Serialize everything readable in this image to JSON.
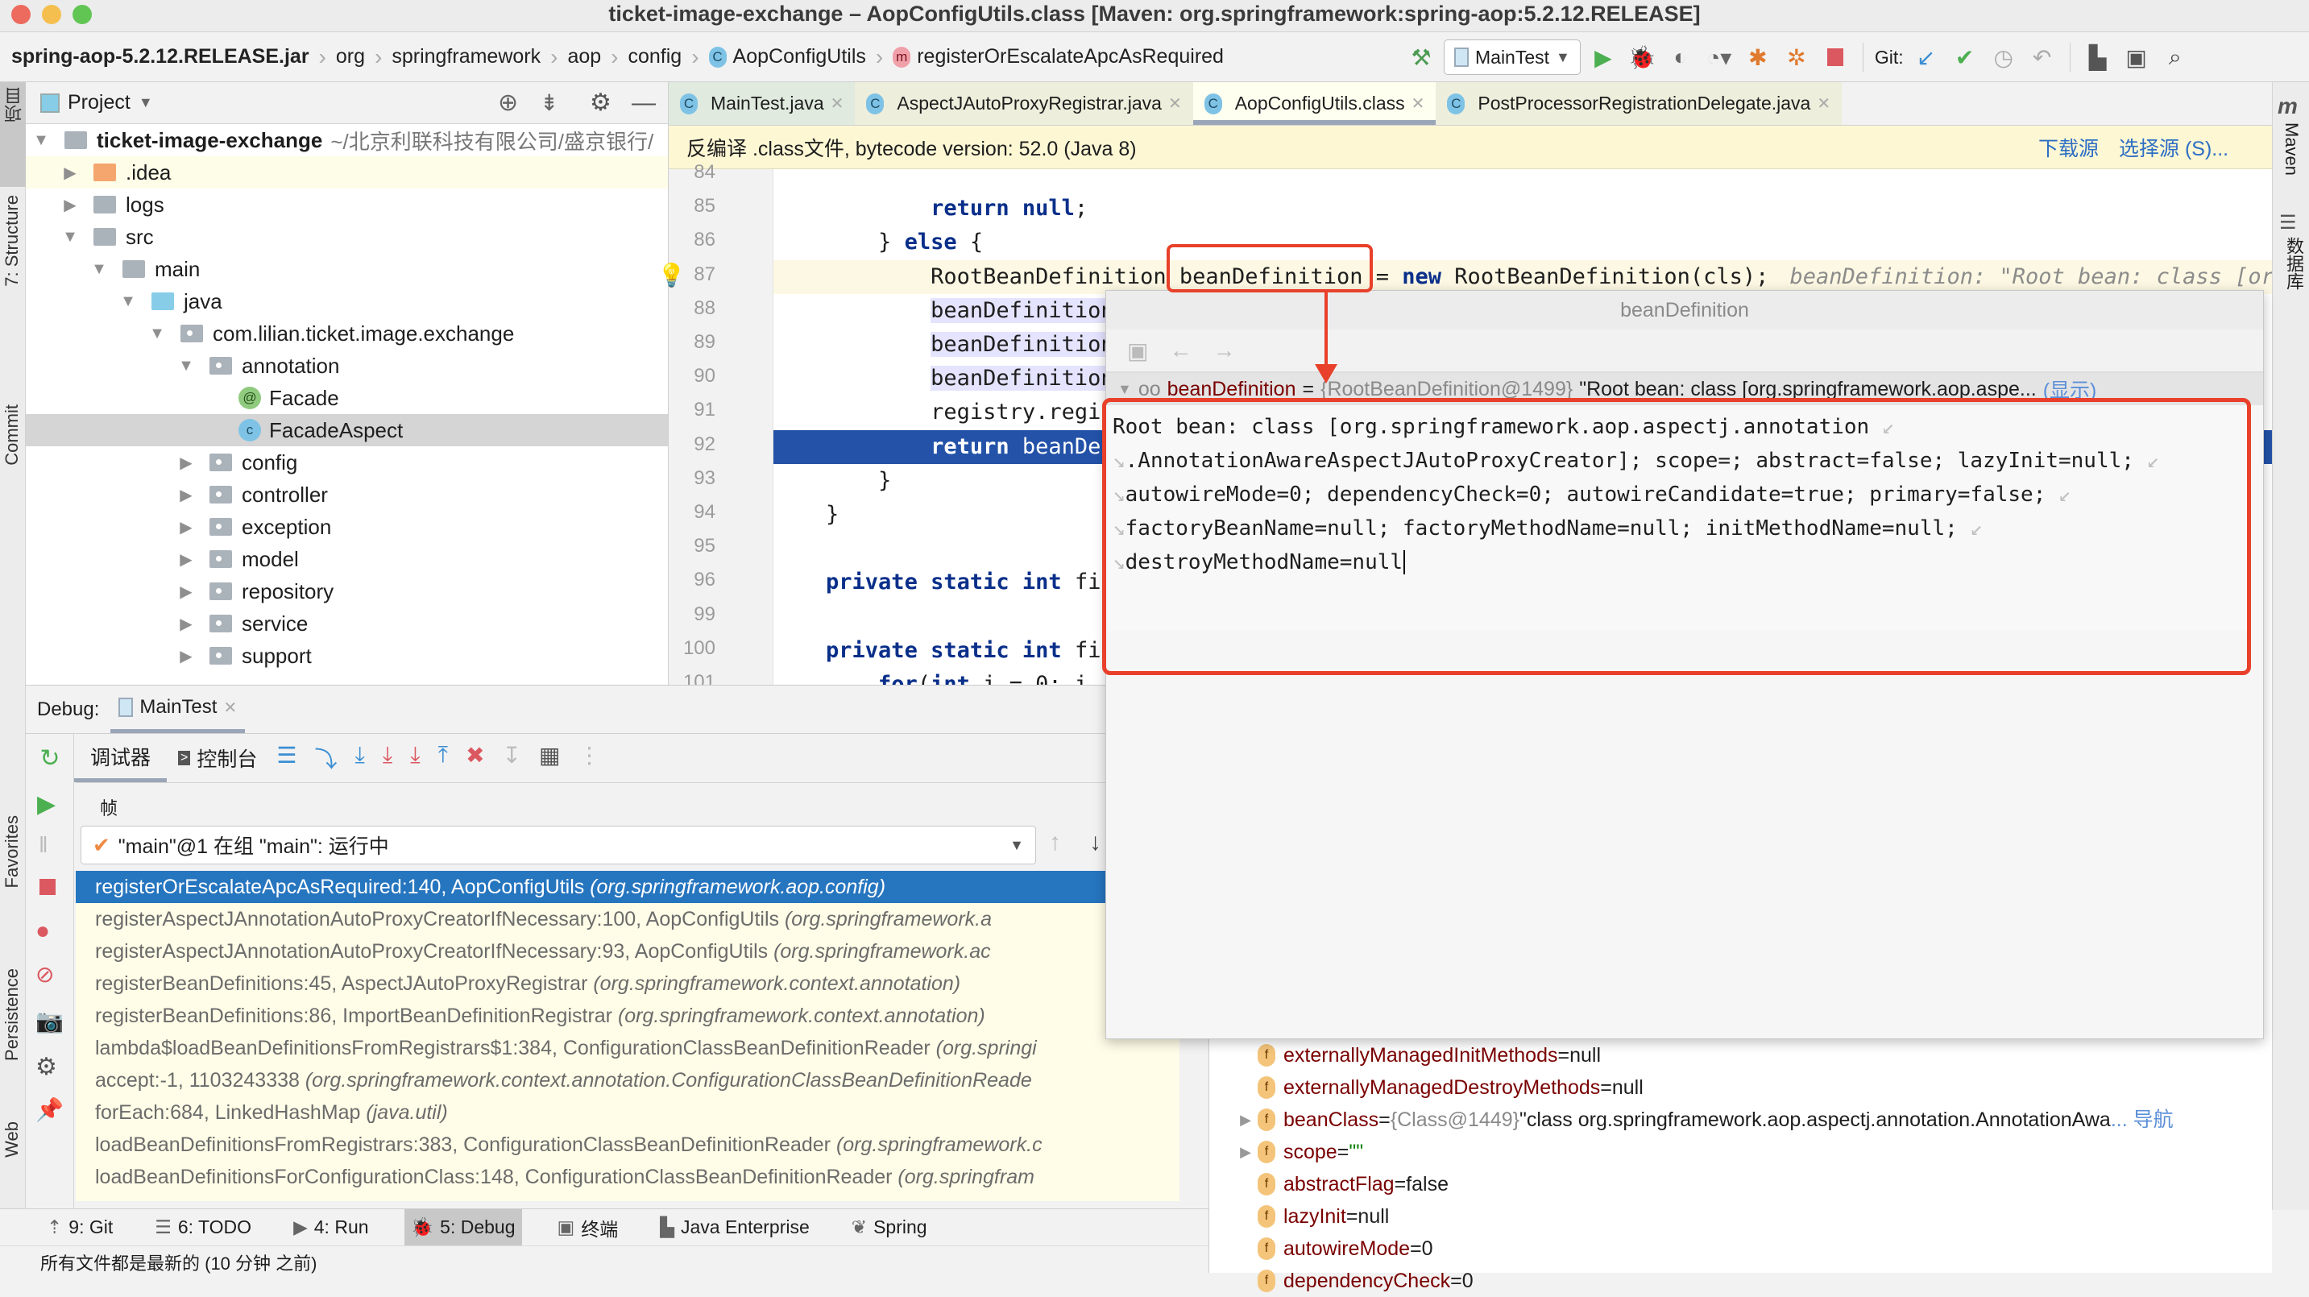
{
  "window": {
    "title": "ticket-image-exchange – AopConfigUtils.class [Maven: org.springframework:spring-aop:5.2.12.RELEASE]",
    "traffic_lights": {
      "close": "#ed6a5e",
      "minimize": "#f5bf4f",
      "zoom": "#61c554"
    }
  },
  "breadcrumb": {
    "items": [
      "spring-aop-5.2.12.RELEASE.jar",
      "org",
      "springframework",
      "aop",
      "config",
      "AopConfigUtils",
      "registerOrEscalateApcAsRequired"
    ],
    "class_badge": "C",
    "method_badge": "m"
  },
  "toolbar": {
    "run_config": "MainTest",
    "git_label": "Git:",
    "icons": [
      "build-hammer-icon",
      "run-icon",
      "debug-icon",
      "coverage-icon",
      "profile-icon",
      "attach-icon",
      "attach-debug-icon",
      "stop-icon",
      "git-update-icon",
      "git-commit-icon",
      "git-history-icon",
      "git-rollback-icon",
      "project-structure-icon",
      "run-anything-icon",
      "search-icon"
    ]
  },
  "left_strip": {
    "items": [
      "项目",
      "7: Structure",
      "Commit",
      "Favorites",
      "Persistence",
      "Web"
    ]
  },
  "right_strip": {
    "items": [
      "Maven",
      "数据库"
    ]
  },
  "project": {
    "header": "Project",
    "root": {
      "name": "ticket-image-exchange",
      "path": "~/北京利联科技有限公司/盛京银行/"
    },
    "tree": [
      {
        "label": ".idea",
        "depth": 1,
        "state": "collapsed",
        "icon": "folder-orange"
      },
      {
        "label": "logs",
        "depth": 1,
        "state": "collapsed",
        "icon": "folder"
      },
      {
        "label": "src",
        "depth": 1,
        "state": "expanded",
        "icon": "folder"
      },
      {
        "label": "main",
        "depth": 2,
        "state": "expanded",
        "icon": "folder"
      },
      {
        "label": "java",
        "depth": 3,
        "state": "expanded",
        "icon": "folder-blue"
      },
      {
        "label": "com.lilian.ticket.image.exchange",
        "depth": 4,
        "state": "expanded",
        "icon": "package"
      },
      {
        "label": "annotation",
        "depth": 5,
        "state": "expanded",
        "icon": "package"
      },
      {
        "label": "Facade",
        "depth": 6,
        "state": "leaf",
        "icon": "annotation"
      },
      {
        "label": "FacadeAspect",
        "depth": 6,
        "state": "leaf",
        "icon": "class",
        "selected": true
      },
      {
        "label": "config",
        "depth": 5,
        "state": "collapsed",
        "icon": "package"
      },
      {
        "label": "controller",
        "depth": 5,
        "state": "collapsed",
        "icon": "package"
      },
      {
        "label": "exception",
        "depth": 5,
        "state": "collapsed",
        "icon": "package"
      },
      {
        "label": "model",
        "depth": 5,
        "state": "collapsed",
        "icon": "package"
      },
      {
        "label": "repository",
        "depth": 5,
        "state": "collapsed",
        "icon": "package"
      },
      {
        "label": "service",
        "depth": 5,
        "state": "collapsed",
        "icon": "package"
      },
      {
        "label": "support",
        "depth": 5,
        "state": "collapsed",
        "icon": "package"
      }
    ]
  },
  "editor": {
    "tabs": [
      {
        "label": "MainTest.java"
      },
      {
        "label": "AspectJAutoProxyRegistrar.java"
      },
      {
        "label": "AopConfigUtils.class",
        "active": true
      },
      {
        "label": "PostProcessorRegistrationDelegate.java"
      }
    ],
    "banner": {
      "text": "反编译 .class文件, bytecode version: 52.0 (Java 8)",
      "download": "下载源",
      "choose": "选择源 (S)..."
    },
    "lines": [
      {
        "n": "84",
        "code": ""
      },
      {
        "n": "85",
        "code": "            return null;"
      },
      {
        "n": "86",
        "code": "        } else {"
      },
      {
        "n": "87",
        "code": "            RootBeanDefinition beanDefinition = new RootBeanDefinition(cls);",
        "inline_hint": "beanDefinition: \"Root bean: class [org"
      },
      {
        "n": "88",
        "code": "            beanDefinition.setSou"
      },
      {
        "n": "89",
        "code": "            beanDefinition.getPro"
      },
      {
        "n": "90",
        "code": "            beanDefinition.setRol"
      },
      {
        "n": "91",
        "code": "            registry.regi"
      },
      {
        "n": "92",
        "code": "            return beanDe",
        "execution": true
      },
      {
        "n": "93",
        "code": "        }"
      },
      {
        "n": "94",
        "code": "    }"
      },
      {
        "n": "95",
        "code": ""
      },
      {
        "n": "96",
        "code": "    private static int fi"
      },
      {
        "n": "99",
        "code": ""
      },
      {
        "n": "100",
        "code": "    private static int fi"
      },
      {
        "n": "101",
        "code": "        for(int i = 0; i"
      }
    ]
  },
  "popup": {
    "title": "beanDefinition",
    "node": {
      "name": "beanDefinition",
      "type": "{RootBeanDefinition@1499}",
      "value": "\"Root bean: class [org.springframework.aop.aspe...",
      "link": "(显示)"
    },
    "text_lines": [
      "Root bean: class [org.springframework.aop.aspectj.annotation",
      ".AnnotationAwareAspectJAutoProxyCreator]; scope=; abstract=false; lazyInit=null;",
      "autowireMode=0; dependencyCheck=0; autowireCandidate=true; primary=false;",
      "factoryBeanName=null; factoryMethodName=null; initMethodName=null;",
      "destroyMethodName=null"
    ]
  },
  "debug": {
    "label": "Debug:",
    "session_tab": "MainTest",
    "tabs": [
      "调试器",
      "控制台"
    ],
    "frames_header": "帧",
    "thread": "\"main\"@1 在组 \"main\": 运行中",
    "frames": [
      {
        "method": "registerOrEscalateApcAsRequired:140, AopConfigUtils",
        "pkg": "(org.springframework.aop.config)",
        "selected": true
      },
      {
        "method": "registerAspectJAnnotationAutoProxyCreatorIfNecessary:100, AopConfigUtils",
        "pkg": "(org.springframework.a"
      },
      {
        "method": "registerAspectJAnnotationAutoProxyCreatorIfNecessary:93, AopConfigUtils",
        "pkg": "(org.springframework.ac"
      },
      {
        "method": "registerBeanDefinitions:45, AspectJAutoProxyRegistrar",
        "pkg": "(org.springframework.context.annotation)"
      },
      {
        "method": "registerBeanDefinitions:86, ImportBeanDefinitionRegistrar",
        "pkg": "(org.springframework.context.annotation)"
      },
      {
        "method": "lambda$loadBeanDefinitionsFromRegistrars$1:384, ConfigurationClassBeanDefinitionReader",
        "pkg": "(org.springi"
      },
      {
        "method": "accept:-1, 1103243338",
        "pkg": "(org.springframework.context.annotation.ConfigurationClassBeanDefinitionReade"
      },
      {
        "method": "forEach:684, LinkedHashMap",
        "pkg": "(java.util)"
      },
      {
        "method": "loadBeanDefinitionsFromRegistrars:383, ConfigurationClassBeanDefinitionReader",
        "pkg": "(org.springframework.c"
      },
      {
        "method": "loadBeanDefinitionsForConfigurationClass:148, ConfigurationClassBeanDefinitionReader",
        "pkg": "(org.springfram"
      }
    ]
  },
  "variables": [
    {
      "name": "externallyManagedInitMethods",
      "eq": " = ",
      "value": "null",
      "partial": true
    },
    {
      "name": "externallyManagedDestroyMethods",
      "eq": " = ",
      "value": "null"
    },
    {
      "name": "beanClass",
      "eq": " = ",
      "type": "{Class@1449}",
      "value": " \"class org.springframework.aop.aspectj.annotation.AnnotationAwa",
      "link": "... 导航",
      "expandable": true
    },
    {
      "name": "scope",
      "eq": " = ",
      "value": "\"\"",
      "string": true,
      "expandable": true
    },
    {
      "name": "abstractFlag",
      "eq": " = ",
      "value": "false"
    },
    {
      "name": "lazyInit",
      "eq": " = ",
      "value": "null"
    },
    {
      "name": "autowireMode",
      "eq": " = ",
      "value": "0"
    },
    {
      "name": "dependencyCheck",
      "eq": " = ",
      "value": "0"
    }
  ],
  "toolwindows": [
    {
      "label": "9: Git"
    },
    {
      "label": "6: TODO"
    },
    {
      "label": "4: Run"
    },
    {
      "label": "5: Debug",
      "active": true
    },
    {
      "label": "终端"
    },
    {
      "label": "Java Enterprise"
    },
    {
      "label": "Spring"
    }
  ],
  "status": {
    "text": "所有文件都是最新的 (10 分钟 之前)"
  }
}
